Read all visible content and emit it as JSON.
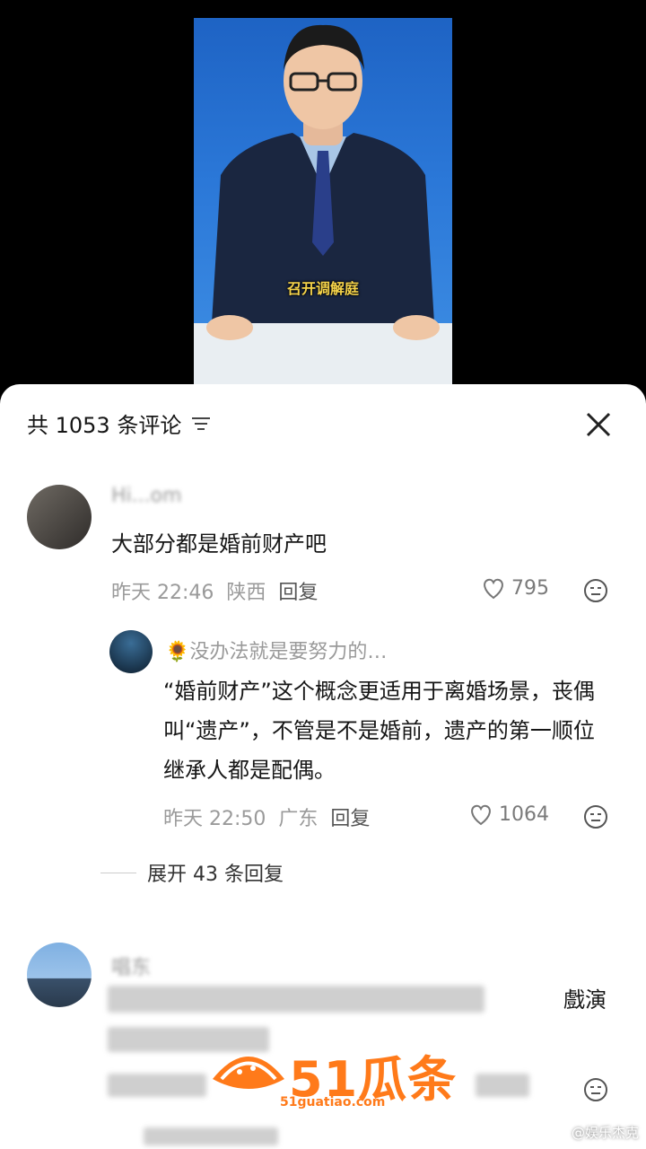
{
  "video": {
    "caption": "召开调解庭"
  },
  "comments_panel": {
    "header": "共 1053 条评论",
    "comments": [
      {
        "username": "Hi...om",
        "text": "大部分都是婚前财产吧",
        "time": "昨天 22:46",
        "location": "陕西",
        "reply_label": "回复",
        "likes": "795"
      },
      {
        "username": "🌻没办法就是要努力的…",
        "text": "“婚前财产”这个概念更适用于离婚场景，丧偶叫“遗产”，不管是不是婚前，遗产的第一顺位继承人都是配偶。",
        "time": "昨天 22:50",
        "location": "广东",
        "reply_label": "回复",
        "likes": "1064"
      }
    ],
    "expand_label": "展开 43 条回复",
    "third_comment": {
      "username": "唱东",
      "visible_text": "戲演"
    }
  },
  "watermark": {
    "brand": "51瓜条",
    "url": "51guatiao.com",
    "credit": "@娱乐杰克"
  },
  "colors": {
    "accent": "#ff7a1a",
    "muted": "#9a9a9a"
  }
}
